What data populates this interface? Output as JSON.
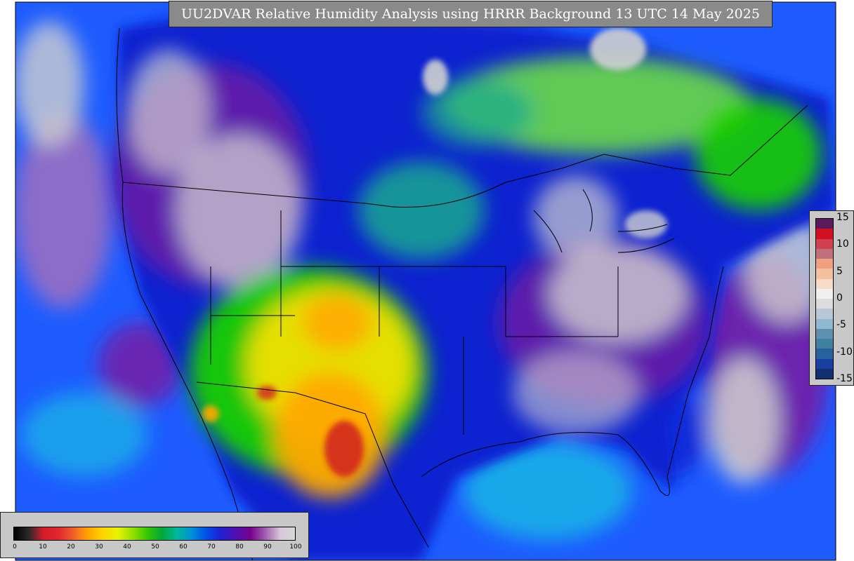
{
  "title": "UU2DVAR Relative Humidity Analysis using HRRR Background 13 UTC 14 May 2025",
  "colorbar_main": {
    "ticks": [
      "0",
      "10",
      "20",
      "30",
      "40",
      "50",
      "60",
      "70",
      "80",
      "90",
      "100"
    ],
    "stops": [
      "#000000",
      "#2a2a2a",
      "#d61c2a",
      "#e0272f",
      "#f0602a",
      "#ffa500",
      "#ffd400",
      "#e9f200",
      "#98e000",
      "#35c800",
      "#00a838",
      "#00b89a",
      "#0090d8",
      "#0050e8",
      "#2020d0",
      "#5010b0",
      "#7a0090",
      "#a060b0",
      "#d9c6d9",
      "#d8d8d8"
    ]
  },
  "colorbar_inc": {
    "ticks": [
      "15",
      "10",
      "5",
      "0",
      "-5",
      "-10",
      "-15"
    ],
    "bands": [
      "#5a1a5a",
      "#d01020",
      "#d04050",
      "#c0707a",
      "#f0a080",
      "#f5c0a0",
      "#f5dcc8",
      "#f0f0f0",
      "#dcdcdc",
      "#b8c8d8",
      "#90b8d0",
      "#6090b0",
      "#4080a0",
      "#2860a0",
      "#1840a0",
      "#103070"
    ]
  },
  "map": {
    "colors": {
      "ocean_blue": "#1e5cff",
      "deep_blue": "#1020d0",
      "cyan": "#1ab0e8",
      "purple": "#7a1aa0",
      "violet": "#a070c0",
      "gray": "#d0d0d0",
      "green": "#18d000",
      "light_green": "#70e840",
      "teal": "#18a890",
      "yellow": "#f0e000",
      "orange": "#ffa800",
      "red": "#d02020",
      "border": "#000000"
    }
  }
}
